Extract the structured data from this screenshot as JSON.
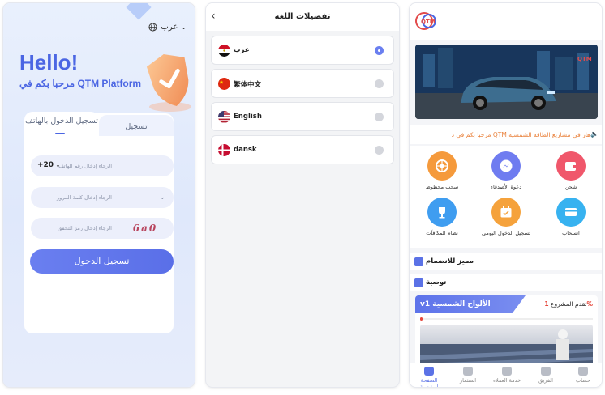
{
  "login": {
    "language_selector": "عرب",
    "hello": "Hello!",
    "welcome": "QTM Platform مرحبا بكم في",
    "tab_phone": "تسجيل الدخول بالهاتف",
    "tab_register": "تسجيل",
    "country_code": "+20",
    "phone_placeholder": "الرجاء إدخال رقم الهاتف",
    "password_placeholder": "الرجاء إدخال كلمة المرور",
    "captcha_placeholder": "الرجاء إدخال رمز التحقق",
    "captcha_text": "6a0",
    "login_button": "تسجيل الدخول"
  },
  "languages": {
    "title": "تفضيلات اللغة",
    "items": [
      {
        "name": "عرب",
        "flag": "egypt",
        "selected": true
      },
      {
        "name": "繁体中文",
        "flag": "china",
        "selected": false
      },
      {
        "name": "English",
        "flag": "usa",
        "selected": false
      },
      {
        "name": "dansk",
        "flag": "denmark",
        "selected": false
      }
    ]
  },
  "home": {
    "logo_text": "QTM",
    "notice": "هار في مشاريع الطاقة الشمسية QTM مرحبا بكم في د",
    "icons": [
      {
        "label": "سحب محظوظ",
        "icon": "wheel-icon",
        "color": "#f59a3c"
      },
      {
        "label": "دعوة الأصدقاء",
        "icon": "messenger-icon",
        "color": "#6f7cf0"
      },
      {
        "label": "شحن",
        "icon": "wallet-icon",
        "color": "#f0576b"
      },
      {
        "label": "نظام المكافآت",
        "icon": "trophy-icon",
        "color": "#3f9df0"
      },
      {
        "label": "تسجيل الدخول اليومي",
        "icon": "calendar-icon",
        "color": "#f5a23c"
      },
      {
        "label": "انسحاب",
        "icon": "card-icon",
        "color": "#37b2f0"
      }
    ],
    "section_membership": "مميز للانضمام",
    "section_recommend": "توصية",
    "product_title": "v1 الألواح الشمسية",
    "product_progress_label": "تقدم المشروع",
    "product_progress_value": "1",
    "product_progress_suffix": "%",
    "tabs": [
      {
        "label": "الصفحة الرئيسية",
        "active": true
      },
      {
        "label": "استثمار",
        "active": false
      },
      {
        "label": "خدمة العملاء",
        "active": false
      },
      {
        "label": "الفريق",
        "active": false
      },
      {
        "label": "حساب",
        "active": false
      }
    ]
  }
}
